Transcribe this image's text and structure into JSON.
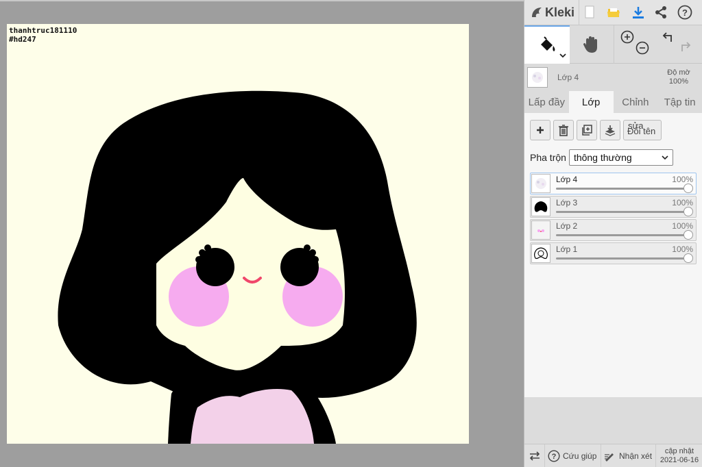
{
  "canvas": {
    "watermark_line1": "thanhtruc181110",
    "watermark_line2": "#hd247",
    "colors": {
      "background": "#fefee9",
      "hair": "#000000",
      "skin": "#fefee2",
      "blush": "#f6a6ef",
      "shirt": "#f3d1e9",
      "mouth": "#f0476b"
    }
  },
  "app": {
    "name": "Kleki",
    "top_icons": [
      "new-file-icon",
      "open-folder-icon",
      "download-icon",
      "share-icon",
      "help-icon"
    ],
    "tools": [
      "fill-bucket-icon",
      "hand-icon",
      "zoom-in-icon",
      "zoom-out-icon",
      "undo-icon",
      "redo-icon"
    ]
  },
  "layer_header": {
    "name": "Lớp 4",
    "opacity_label": "Độ mờ",
    "opacity_value": "100%"
  },
  "tabs": [
    {
      "label": "Lấp đầy",
      "active": false
    },
    {
      "label": "Lớp",
      "active": true
    },
    {
      "label": "Chỉnh",
      "active": false
    },
    {
      "label": "Tập tin",
      "active": false
    }
  ],
  "layer_actions": {
    "rename_top": "sửa",
    "rename_label": "Đổi tên"
  },
  "blend": {
    "label": "Pha trộn",
    "value": "thông thường"
  },
  "layers": [
    {
      "name": "Lớp 4",
      "opacity": "100%",
      "selected": true
    },
    {
      "name": "Lớp 3",
      "opacity": "100%",
      "selected": false
    },
    {
      "name": "Lớp 2",
      "opacity": "100%",
      "selected": false
    },
    {
      "name": "Lớp 1",
      "opacity": "100%",
      "selected": false
    }
  ],
  "footer": {
    "help_label": "Cứu giúp",
    "feedback_label": "Nhận xét",
    "update_label": "cập nhật",
    "update_date": "2021-06-16"
  }
}
